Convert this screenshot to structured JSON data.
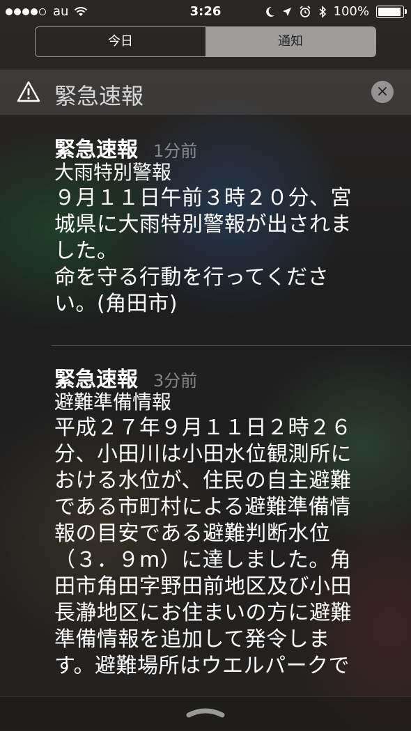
{
  "status_bar": {
    "carrier": "au",
    "time": "3:26",
    "battery": "100%",
    "signal_bars_filled": 4,
    "signal_bars_total": 5
  },
  "segments": [
    {
      "label": "今日",
      "active": false
    },
    {
      "label": "通知",
      "active": true
    }
  ],
  "section": {
    "title": "緊急速報",
    "icon": "warning-triangle-icon",
    "close_icon": "close-icon",
    "close_glyph": "×"
  },
  "notifications": [
    {
      "app": "緊急速報",
      "time": "1分前",
      "title": "大雨特別警報",
      "lines": [
        "９月１１日午前３時２０分、宮",
        "城県に大雨特別警報が出されま",
        "した。",
        "命を守る行動を行ってくださ",
        "い。(角田市)"
      ]
    },
    {
      "app": "緊急速報",
      "time": "3分前",
      "title": "避難準備情報",
      "lines": [
        "平成２７年９月１１日２時２６",
        "分、小田川は小田水位観測所に",
        "おける水位が、住民の自主避難",
        "である市町村による避難準備情",
        "報の目安である避難判断水位",
        "（３．９m）に達しました。角",
        "田市角田字野田前地区及び小田",
        "長瀞地区にお住まいの方に避難",
        "準備情報を追加して発令しま",
        "す。避難場所はウエルパークで"
      ]
    }
  ],
  "colors": {
    "text": "#ffffff",
    "muted": "rgba(255,255,255,0.45)"
  }
}
